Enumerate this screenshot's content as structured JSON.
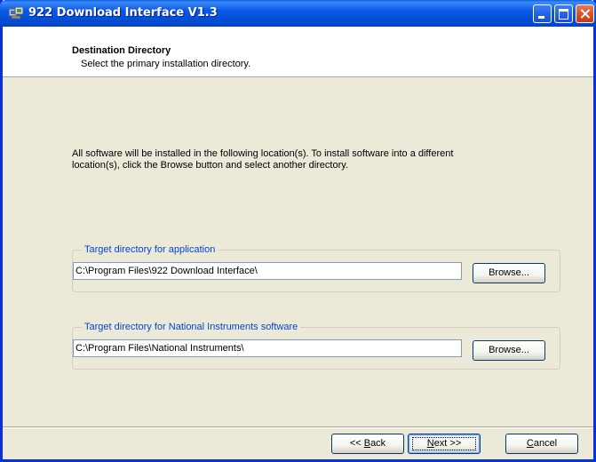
{
  "window": {
    "title": "922 Download Interface V1.3"
  },
  "header": {
    "title": "Destination Directory",
    "subtitle": "Select the primary installation directory."
  },
  "intro_text": "All software will be installed in the following location(s). To install software into a different location(s), click the Browse button and select another directory.",
  "groups": [
    {
      "label": "Target directory for application",
      "path": "C:\\Program Files\\922 Download Interface\\",
      "browse_label": "Browse..."
    },
    {
      "label": "Target directory for National Instruments software",
      "path": "C:\\Program Files\\National Instruments\\",
      "browse_label": "Browse..."
    }
  ],
  "footer": {
    "back_prefix": "<< ",
    "back_key": "B",
    "back_rest": "ack",
    "next_key": "N",
    "next_rest": "ext >>",
    "cancel_key": "C",
    "cancel_rest": "ancel"
  },
  "colors": {
    "titlebar": "#0A58E8",
    "group_label": "#0046D5",
    "dialog_bg": "#ECE9D8"
  }
}
